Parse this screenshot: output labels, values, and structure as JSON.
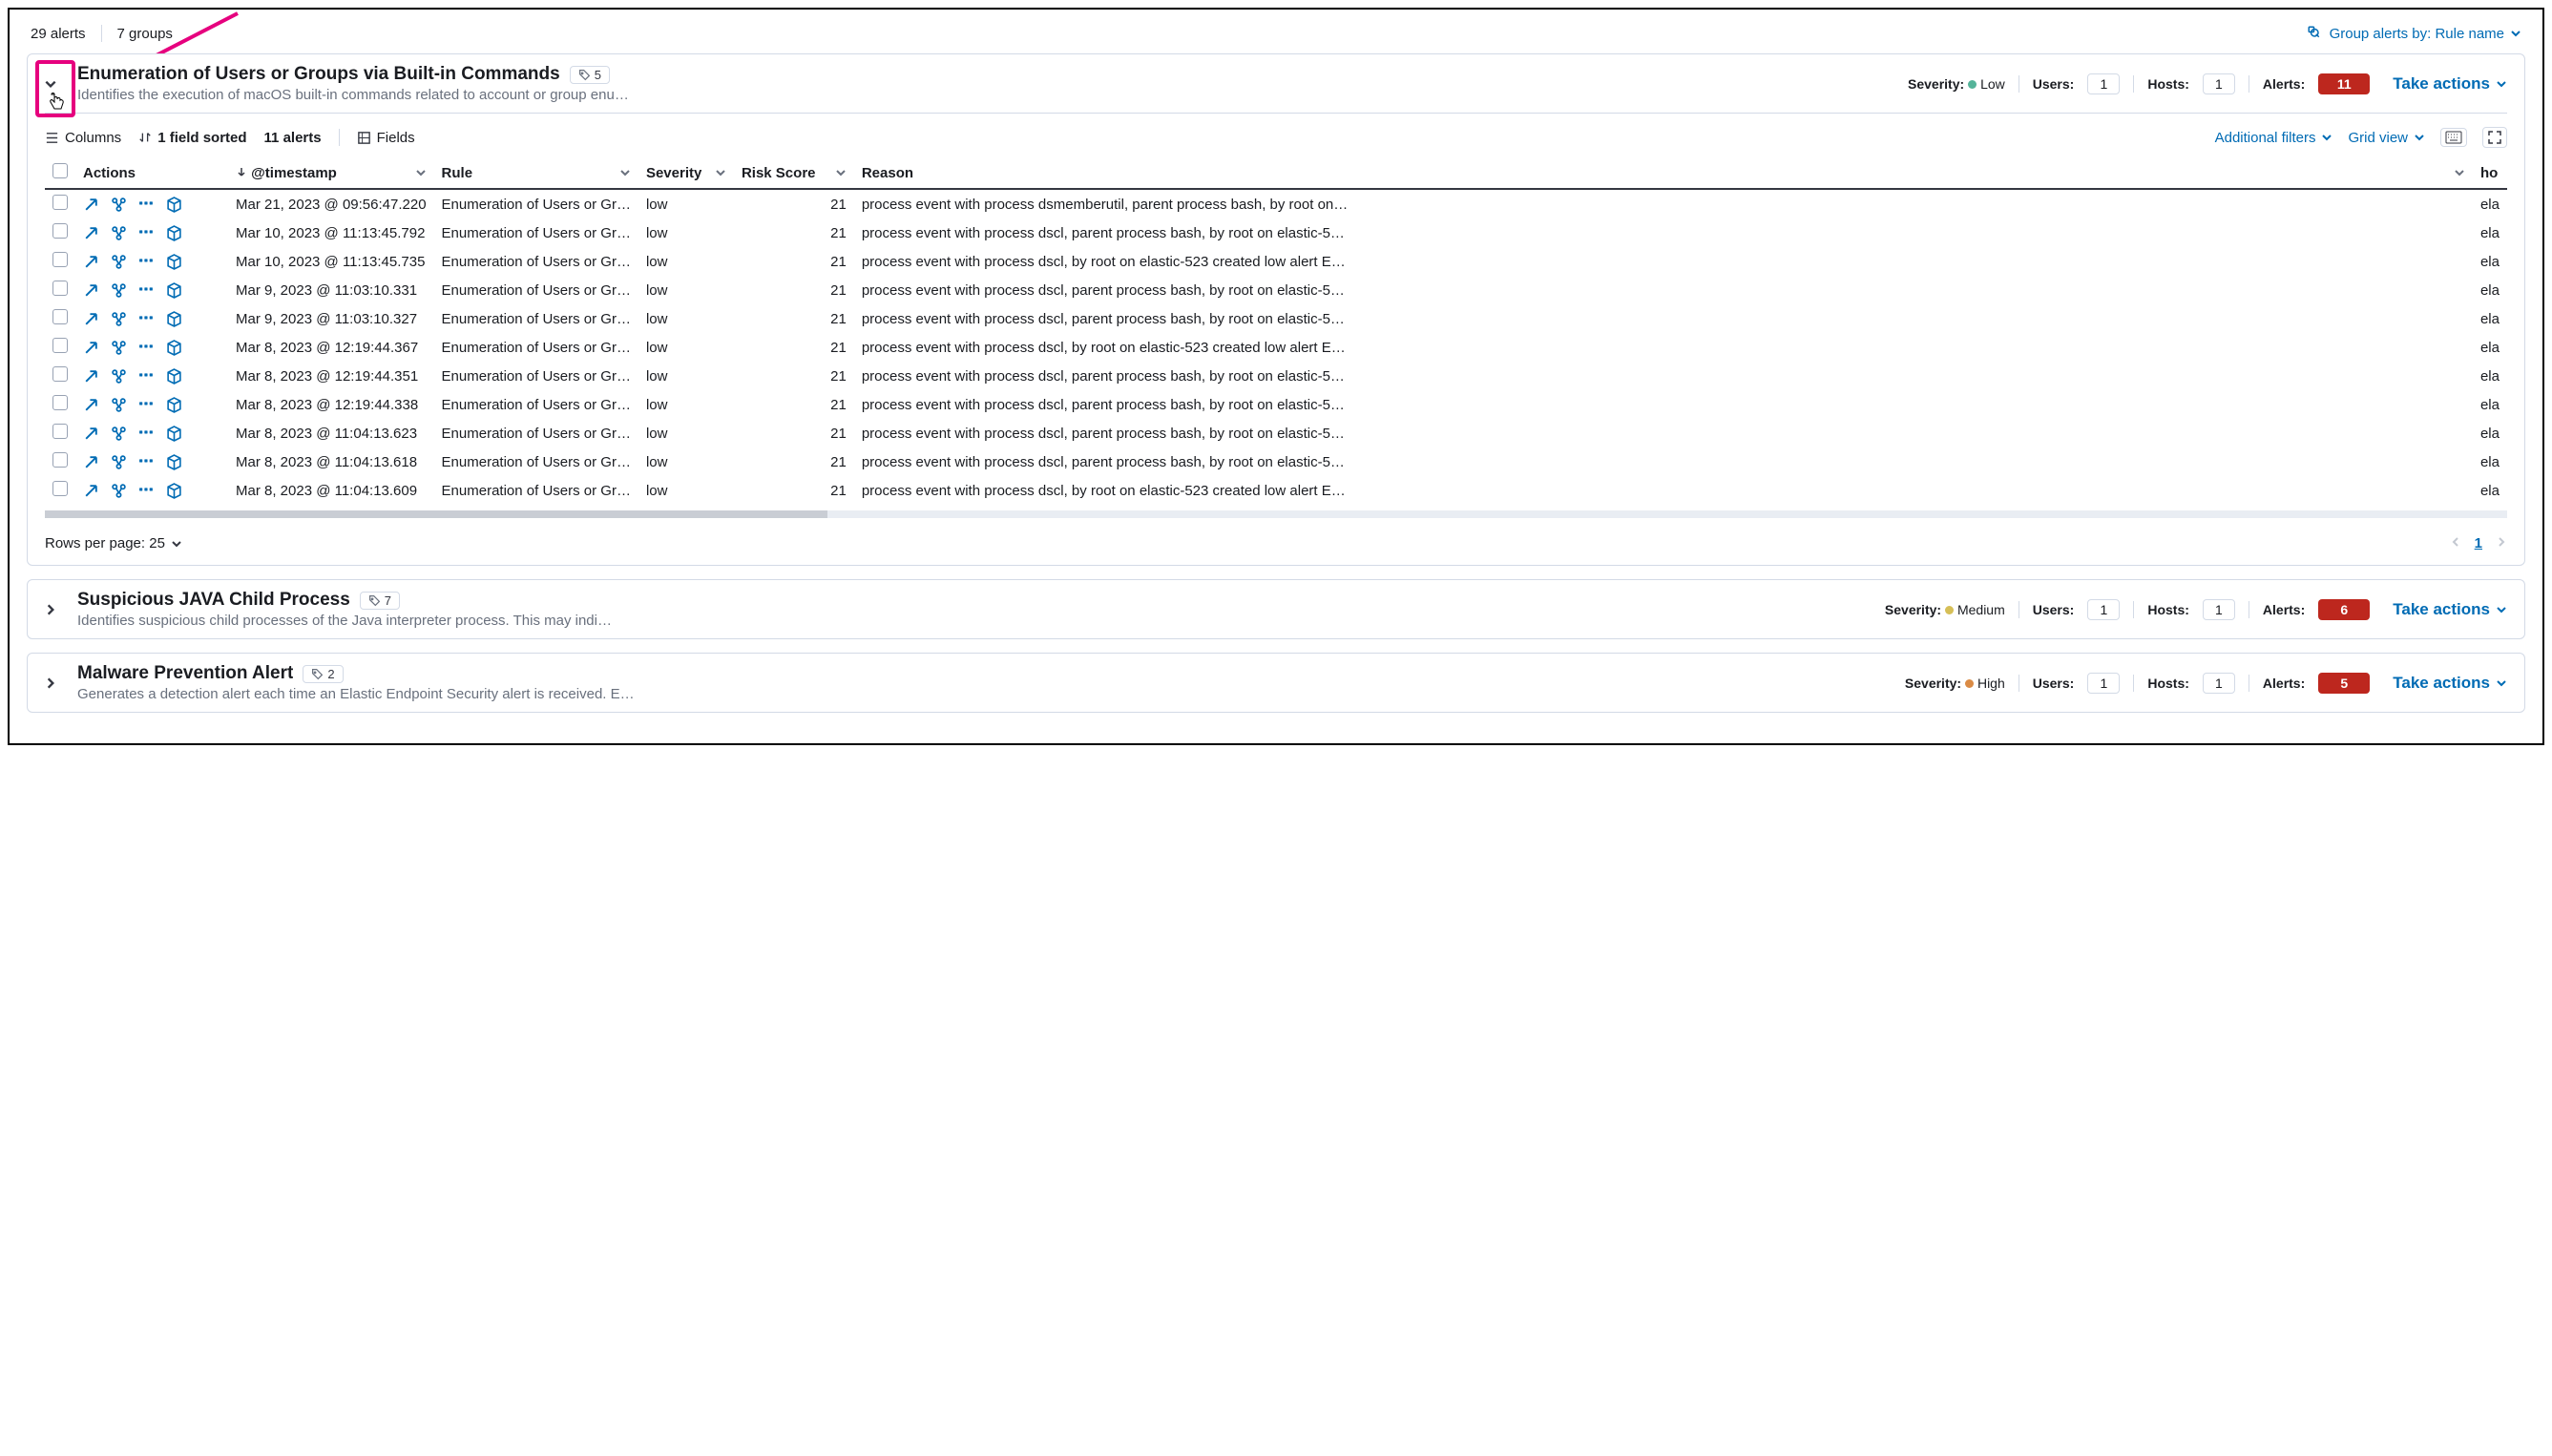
{
  "topbar": {
    "alerts_count": "29 alerts",
    "groups_count": "7 groups",
    "group_by_label": "Group alerts by: Rule name"
  },
  "groups": [
    {
      "title": "Enumeration of Users or Groups via Built-in Commands",
      "desc": "Identifies the execution of macOS built-in commands related to account or group enu…",
      "tag_count": "5",
      "severity_label": "Severity:",
      "severity_value": "Low",
      "severity_class": "sev-low",
      "users_label": "Users:",
      "users_value": "1",
      "hosts_label": "Hosts:",
      "hosts_value": "1",
      "alerts_label": "Alerts:",
      "alerts_value": "11",
      "take_actions": "Take actions",
      "expanded": true
    },
    {
      "title": "Suspicious JAVA Child Process",
      "desc": "Identifies suspicious child processes of the Java interpreter process. This may indi…",
      "tag_count": "7",
      "severity_label": "Severity:",
      "severity_value": "Medium",
      "severity_class": "sev-medium",
      "users_label": "Users:",
      "users_value": "1",
      "hosts_label": "Hosts:",
      "hosts_value": "1",
      "alerts_label": "Alerts:",
      "alerts_value": "6",
      "take_actions": "Take actions",
      "expanded": false
    },
    {
      "title": "Malware Prevention Alert",
      "desc": "Generates a detection alert each time an Elastic Endpoint Security alert is received. E…",
      "tag_count": "2",
      "severity_label": "Severity:",
      "severity_value": "High",
      "severity_class": "sev-high",
      "users_label": "Users:",
      "users_value": "1",
      "hosts_label": "Hosts:",
      "hosts_value": "1",
      "alerts_label": "Alerts:",
      "alerts_value": "5",
      "take_actions": "Take actions",
      "expanded": false
    }
  ],
  "toolbar": {
    "columns": "Columns",
    "sort": "1 field sorted",
    "alerts_count": "11 alerts",
    "fields": "Fields",
    "additional_filters": "Additional filters",
    "grid_view": "Grid view"
  },
  "table": {
    "headers": {
      "actions": "Actions",
      "timestamp": "@timestamp",
      "rule": "Rule",
      "severity": "Severity",
      "risk": "Risk Score",
      "reason": "Reason",
      "host": "ho"
    },
    "rows": [
      {
        "ts": "Mar 21, 2023 @ 09:56:47.220",
        "rule": "Enumeration of Users or Gr…",
        "sev": "low",
        "risk": "21",
        "reason": "process event with process dsmemberutil, parent process bash, by root on…",
        "host": "ela"
      },
      {
        "ts": "Mar 10, 2023 @ 11:13:45.792",
        "rule": "Enumeration of Users or Gr…",
        "sev": "low",
        "risk": "21",
        "reason": "process event with process dscl, parent process bash, by root on elastic-5…",
        "host": "ela"
      },
      {
        "ts": "Mar 10, 2023 @ 11:13:45.735",
        "rule": "Enumeration of Users or Gr…",
        "sev": "low",
        "risk": "21",
        "reason": "process event with process dscl, by root on elastic-523 created low alert E…",
        "host": "ela"
      },
      {
        "ts": "Mar 9, 2023 @ 11:03:10.331",
        "rule": "Enumeration of Users or Gr…",
        "sev": "low",
        "risk": "21",
        "reason": "process event with process dscl, parent process bash, by root on elastic-5…",
        "host": "ela"
      },
      {
        "ts": "Mar 9, 2023 @ 11:03:10.327",
        "rule": "Enumeration of Users or Gr…",
        "sev": "low",
        "risk": "21",
        "reason": "process event with process dscl, parent process bash, by root on elastic-5…",
        "host": "ela"
      },
      {
        "ts": "Mar 8, 2023 @ 12:19:44.367",
        "rule": "Enumeration of Users or Gr…",
        "sev": "low",
        "risk": "21",
        "reason": "process event with process dscl, by root on elastic-523 created low alert E…",
        "host": "ela"
      },
      {
        "ts": "Mar 8, 2023 @ 12:19:44.351",
        "rule": "Enumeration of Users or Gr…",
        "sev": "low",
        "risk": "21",
        "reason": "process event with process dscl, parent process bash, by root on elastic-5…",
        "host": "ela"
      },
      {
        "ts": "Mar 8, 2023 @ 12:19:44.338",
        "rule": "Enumeration of Users or Gr…",
        "sev": "low",
        "risk": "21",
        "reason": "process event with process dscl, parent process bash, by root on elastic-5…",
        "host": "ela"
      },
      {
        "ts": "Mar 8, 2023 @ 11:04:13.623",
        "rule": "Enumeration of Users or Gr…",
        "sev": "low",
        "risk": "21",
        "reason": "process event with process dscl, parent process bash, by root on elastic-5…",
        "host": "ela"
      },
      {
        "ts": "Mar 8, 2023 @ 11:04:13.618",
        "rule": "Enumeration of Users or Gr…",
        "sev": "low",
        "risk": "21",
        "reason": "process event with process dscl, parent process bash, by root on elastic-5…",
        "host": "ela"
      },
      {
        "ts": "Mar 8, 2023 @ 11:04:13.609",
        "rule": "Enumeration of Users or Gr…",
        "sev": "low",
        "risk": "21",
        "reason": "process event with process dscl, by root on elastic-523 created low alert E…",
        "host": "ela"
      }
    ],
    "footer": {
      "rows_per_page": "Rows per page: 25",
      "page": "1"
    }
  }
}
